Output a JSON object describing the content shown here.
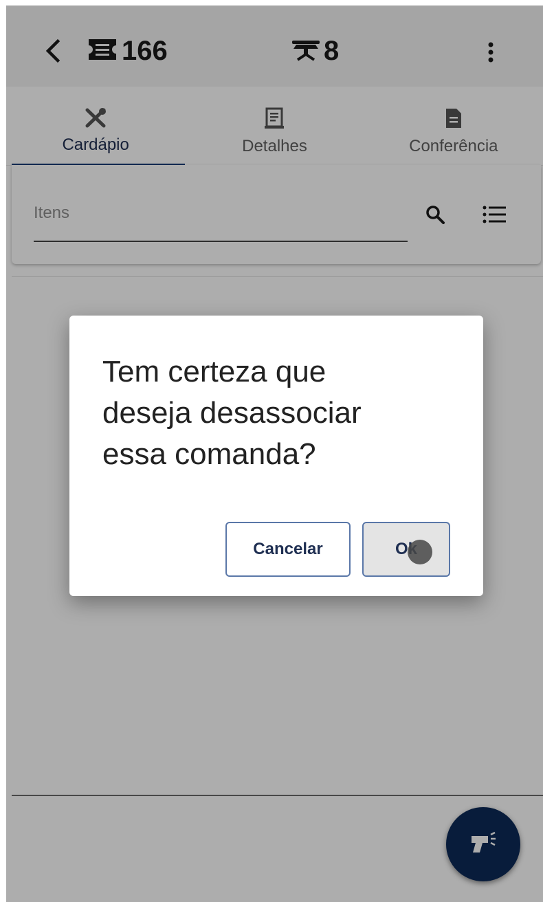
{
  "header": {
    "back_icon": "chevron-left-icon",
    "ticket_icon": "ticket-icon",
    "ticket_number": "166",
    "table_icon": "table-icon",
    "table_number": "8",
    "menu_icon": "more-vert-icon"
  },
  "tabs": [
    {
      "label": "Cardápio",
      "icon": "utensils-icon",
      "active": true
    },
    {
      "label": "Detalhes",
      "icon": "notepad-icon",
      "active": false
    },
    {
      "label": "Conferência",
      "icon": "document-icon",
      "active": false
    }
  ],
  "search": {
    "placeholder": "Itens",
    "value": "",
    "search_icon": "search-icon",
    "list_icon": "list-icon"
  },
  "dialog": {
    "message": "Tem certeza que deseja desassociar essa comanda?",
    "cancel_label": "Cancelar",
    "ok_label": "Ok"
  },
  "fab": {
    "icon": "barcode-scanner-icon"
  },
  "colors": {
    "header_bg": "#f3f3f3",
    "accent": "#1c3f7a",
    "fab_bg": "#0d2a58",
    "button_text": "#1f2f52",
    "button_border": "#5a77a8"
  }
}
